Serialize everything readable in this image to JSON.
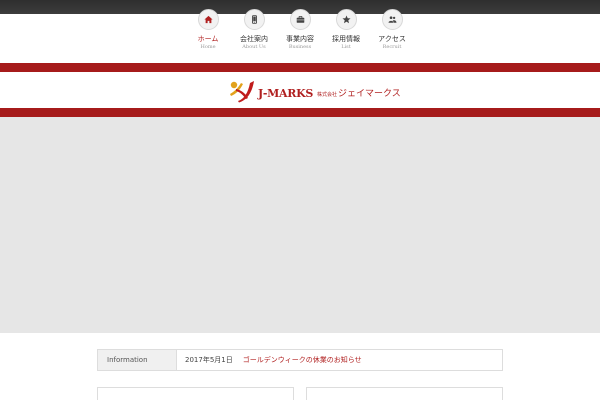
{
  "nav": {
    "items": [
      {
        "label": "ホーム",
        "sub": "Home",
        "icon": "home-icon",
        "active": true
      },
      {
        "label": "会社案内",
        "sub": "About Us",
        "icon": "mobile-icon",
        "active": false
      },
      {
        "label": "事業内容",
        "sub": "Business",
        "icon": "briefcase-icon",
        "active": false
      },
      {
        "label": "採用情報",
        "sub": "List",
        "icon": "star-icon",
        "active": false
      },
      {
        "label": "アクセス",
        "sub": "Recruit",
        "icon": "people-icon",
        "active": false
      }
    ]
  },
  "logo": {
    "brand": "J-MARKS",
    "company_prefix": "株式会社",
    "company_name": "ジェイマークス"
  },
  "info": {
    "label": "Information",
    "date": "2017年5月1日",
    "headline": "ゴールデンウィークの休業のお知らせ"
  },
  "colors": {
    "accent": "#a61b1b",
    "hero": "#e6e6e6",
    "dark_bar": "#333333"
  }
}
